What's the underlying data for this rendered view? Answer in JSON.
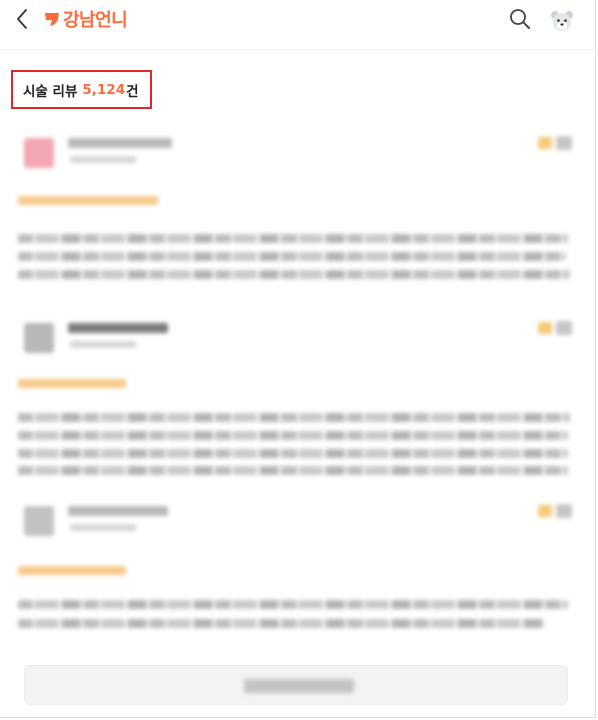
{
  "header": {
    "logo_text": "강남언니",
    "icons": {
      "back": "chevron-left-icon",
      "search": "search-icon",
      "avatar": "bear-avatar-icon"
    },
    "brand_color": "#ff6a3d"
  },
  "reviews_section": {
    "title_prefix": "시술 리뷰",
    "count": "5,124",
    "count_unit": "건",
    "highlight_color": "#e0252b"
  }
}
